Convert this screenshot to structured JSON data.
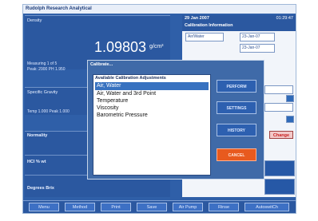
{
  "window": {
    "title": "Rudolph Research Analytical"
  },
  "density": {
    "label": "Density",
    "reading": "1.09803",
    "unit": "g/cm³",
    "measuring": "Measuring 1 of 5",
    "peak": "Peak: 2900 PH 1.950"
  },
  "sections": {
    "specific_gravity": "Specific Gravity",
    "temp_comp": "Temp 1.000 Peak 1.000",
    "normality": "Normality",
    "hcl": "HCl % wt",
    "degrees_brix": "Degrees Brix"
  },
  "right_panel": {
    "date": "29 Jan 2007",
    "time": "01:29:47",
    "heading": "Calibration Information",
    "calib_rows": [
      {
        "name": "Air/Water",
        "date": "23-Jan-07"
      },
      {
        "name": "",
        "date": "23-Jan-07"
      }
    ],
    "change_label": "Change"
  },
  "dialog": {
    "title": "Calibrate...",
    "list_heading": "Available Calibration Adjustments",
    "items": [
      {
        "label": "Air, Water",
        "selected": true
      },
      {
        "label": "Air, Water and 3rd Point",
        "selected": false
      },
      {
        "label": "Temperature",
        "selected": false
      },
      {
        "label": "Viscosity",
        "selected": false
      },
      {
        "label": "Barometric Pressure",
        "selected": false
      }
    ],
    "buttons": {
      "perform": "PERFORM",
      "settings": "SETTINGS",
      "history": "HISTORY",
      "cancel": "CANCEL"
    }
  },
  "toolbar": {
    "menu": "Menu",
    "method": "Method",
    "print": "Print",
    "save": "Save",
    "air_pump": "Air Pump",
    "rinse": "Rinse",
    "autoswitch": "AutoswitCh"
  },
  "colors": {
    "panel": "#2b58a0",
    "selection": "#3872c0",
    "cancel": "#e85a1e",
    "change": "#c81e1e"
  }
}
